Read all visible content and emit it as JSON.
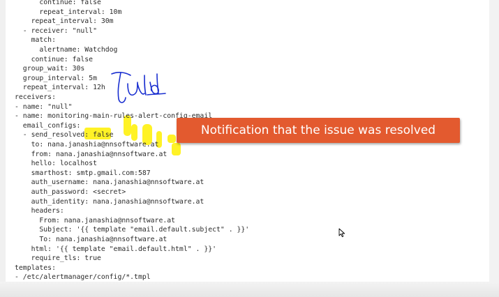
{
  "code": {
    "lines": [
      "      continue: false",
      "      repeat_interval: 10m",
      "    repeat_interval: 30m",
      "  - receiver: \"null\"",
      "    match:",
      "      alertname: Watchdog",
      "    continue: false",
      "  group_wait: 30s",
      "  group_interval: 5m",
      "  repeat_interval: 12h",
      "receivers:",
      "- name: \"null\"",
      "- name: monitoring-main-rules-alert-config-email",
      "  email_configs:",
      "  - send_resolved: false",
      "    to: nana.janashia@nnsoftware.at",
      "    from: nana.janashia@nnsoftware.at",
      "    hello: localhost",
      "    smarthost: smtp.gmail.com:587",
      "    auth_username: nana.janashia@nnsoftware.at",
      "    auth_password: <secret>",
      "    auth_identity: nana.janashia@nnsoftware.at",
      "    headers:",
      "      From: nana.janashia@nnsoftware.at",
      "      Subject: '{{ template \"email.default.subject\" . }}'",
      "      To: nana.janashia@nnsoftware.at",
      "    html: '{{ template \"email.default.html\" . }}'",
      "    require_tls: true",
      "templates:",
      "- /etc/alertmanager/config/*.tmpl"
    ]
  },
  "callout": {
    "text": "Notification that the issue was resolved"
  },
  "colors": {
    "callout_background": "#e35a2f",
    "highlighter": "#fff000",
    "scribble_ink": "#1a2fd0",
    "code_text": "#2b2b2b"
  },
  "annotations": {
    "scribble_icon": "handwritten-true-scribble",
    "highlight_icon": "yellow-highlighter-marks"
  }
}
